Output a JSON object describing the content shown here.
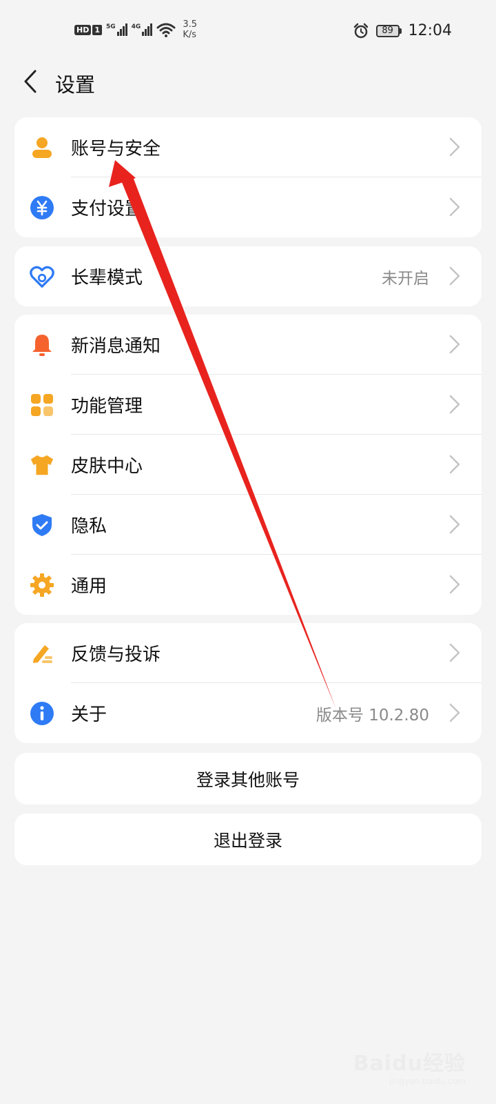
{
  "status_bar": {
    "hd": "HD",
    "sim": "1",
    "net1": "5G",
    "net2": "4G",
    "speed_value": "3.5",
    "speed_unit": "K/s",
    "battery": "89",
    "time": "12:04"
  },
  "header": {
    "title": "设置",
    "back_icon": "chevron-left-icon"
  },
  "groups": [
    {
      "items": [
        {
          "label": "账号与安全",
          "icon": "person-icon",
          "color": "#F5A623"
        },
        {
          "label": "支付设置",
          "icon": "yuan-coin-icon",
          "color": "#2F7BF5"
        }
      ]
    },
    {
      "items": [
        {
          "label": "长辈模式",
          "value": "未开启",
          "icon": "heart-person-icon",
          "color": "#2F7BF5"
        }
      ]
    },
    {
      "items": [
        {
          "label": "新消息通知",
          "icon": "bell-icon",
          "color": "#F5622E"
        },
        {
          "label": "功能管理",
          "icon": "grid-apps-icon",
          "color": "#F5A623"
        },
        {
          "label": "皮肤中心",
          "icon": "tshirt-icon",
          "color": "#F5A623"
        },
        {
          "label": "隐私",
          "icon": "shield-check-icon",
          "color": "#2F7BF5"
        },
        {
          "label": "通用",
          "icon": "gear-icon",
          "color": "#F5A623"
        }
      ]
    },
    {
      "items": [
        {
          "label": "反馈与投诉",
          "icon": "pencil-icon",
          "color": "#F5A623"
        },
        {
          "label": "关于",
          "value": "版本号 10.2.80",
          "icon": "info-icon",
          "color": "#2F7BF5"
        }
      ]
    }
  ],
  "buttons": {
    "switch_account": "登录其他账号",
    "logout": "退出登录"
  },
  "annotation_color": "#E8231E",
  "watermark": {
    "main": "Baidu经验",
    "sub": "jingyan.baidu.com"
  }
}
